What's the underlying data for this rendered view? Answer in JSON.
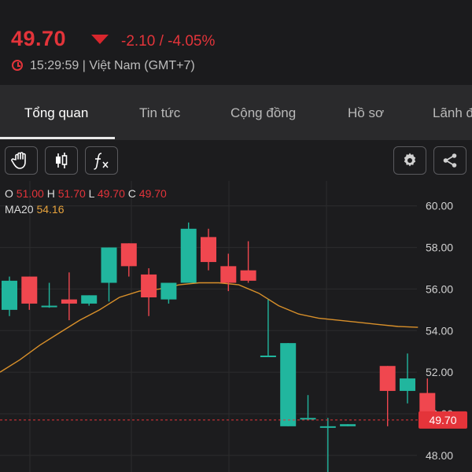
{
  "header": {
    "price": "49.70",
    "change": "-2.10 / -4.05%",
    "time": "15:29:59 | Việt Nam (GMT+7)"
  },
  "tabs": [
    {
      "label": "Tổng quan",
      "active": true
    },
    {
      "label": "Tin tức"
    },
    {
      "label": "Cộng đồng"
    },
    {
      "label": "Hồ sơ"
    },
    {
      "label": "Lãnh đ"
    }
  ],
  "toolbar": {
    "icons": [
      "hand-icon",
      "candlestick-icon",
      "fx-icon",
      "gear-icon",
      "share-icon"
    ]
  },
  "ohlc": {
    "o_label": "O",
    "o": "51.00",
    "h_label": "H",
    "h": "51.70",
    "l_label": "L",
    "l": "49.70",
    "c_label": "C",
    "c": "49.70"
  },
  "ma": {
    "label": "MA20",
    "value": "54.16"
  },
  "colors": {
    "up": "#21b69e",
    "down": "#f0474f",
    "ma": "#d9902a",
    "price_badge": "#e4343a"
  },
  "chart_data": {
    "type": "candlestick",
    "y_axis": {
      "ticks": [
        "60.00",
        "58.00",
        "56.00",
        "54.00",
        "52.00",
        "50.00",
        "48.00"
      ],
      "range": [
        47.2,
        61.2
      ]
    },
    "last_price_label": "49.70",
    "candles": [
      {
        "o": 55.0,
        "h": 56.6,
        "l": 54.7,
        "c": 56.4
      },
      {
        "o": 56.6,
        "h": 56.6,
        "l": 55.0,
        "c": 55.3
      },
      {
        "o": 55.2,
        "h": 56.3,
        "l": 55.1,
        "c": 55.2
      },
      {
        "o": 55.5,
        "h": 56.8,
        "l": 54.5,
        "c": 55.3
      },
      {
        "o": 55.3,
        "h": 55.7,
        "l": 55.2,
        "c": 55.7
      },
      {
        "o": 56.3,
        "h": 58.0,
        "l": 55.4,
        "c": 58.0
      },
      {
        "o": 58.2,
        "h": 58.2,
        "l": 56.6,
        "c": 57.1
      },
      {
        "o": 56.7,
        "h": 57.0,
        "l": 54.7,
        "c": 55.6
      },
      {
        "o": 55.5,
        "h": 56.3,
        "l": 55.3,
        "c": 56.3
      },
      {
        "o": 56.3,
        "h": 59.2,
        "l": 56.3,
        "c": 58.9
      },
      {
        "o": 58.5,
        "h": 58.9,
        "l": 56.9,
        "c": 57.3
      },
      {
        "o": 57.1,
        "h": 57.7,
        "l": 55.9,
        "c": 56.3
      },
      {
        "o": 56.9,
        "h": 58.3,
        "l": 56.3,
        "c": 56.4
      },
      {
        "o": 52.8,
        "h": 55.5,
        "l": 52.8,
        "c": 52.8
      },
      {
        "o": 49.4,
        "h": 53.4,
        "l": 49.4,
        "c": 53.4
      },
      {
        "o": 49.8,
        "h": 50.9,
        "l": 49.8,
        "c": 49.8
      },
      {
        "o": 49.4,
        "h": 49.8,
        "l": 46.5,
        "c": 49.4
      },
      {
        "o": 49.4,
        "h": 49.5,
        "l": 49.4,
        "c": 49.5
      },
      {
        "o": null,
        "h": null,
        "l": null,
        "c": null
      },
      {
        "o": 52.3,
        "h": 52.3,
        "l": 49.4,
        "c": 51.1
      },
      {
        "o": 51.1,
        "h": 52.9,
        "l": 50.5,
        "c": 51.7
      },
      {
        "o": 51.0,
        "h": 51.7,
        "l": 49.7,
        "c": 49.7
      }
    ],
    "ma20": [
      52.0,
      52.6,
      53.3,
      53.9,
      54.5,
      55.0,
      55.6,
      55.9,
      56.0,
      56.2,
      56.3,
      56.3,
      56.2,
      55.8,
      55.2,
      54.8,
      54.6,
      54.5,
      54.4,
      54.3,
      54.2,
      54.16
    ]
  }
}
